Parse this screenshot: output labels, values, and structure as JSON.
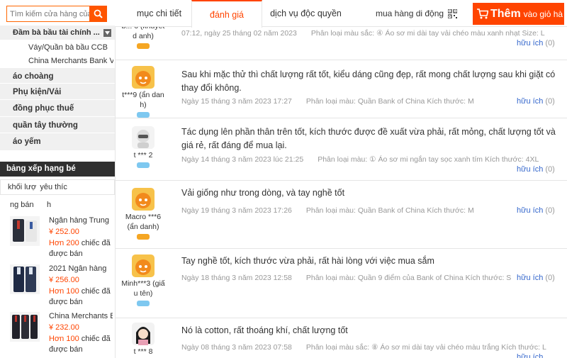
{
  "search": {
    "placeholder": "Tìm kiếm cửa hàng của"
  },
  "categories": {
    "header": "Đầm bà bầu tài chính ...",
    "subitems": [
      "Váy/Quần bà bầu CCB",
      "China Merchants Bank Vá..."
    ],
    "items": [
      "áo choàng",
      "Phụ kiện/Vải",
      "đồng phục thuế",
      "quần tây thường",
      "áo yếm"
    ]
  },
  "ranking": {
    "title": "bảng xếp hạng bé",
    "tabs": [
      "khối lượ",
      "yêu thíc"
    ],
    "cols": [
      "ng bán",
      "h"
    ],
    "items": [
      {
        "name": "Ngân hàng Trung",
        "price": "¥ 252.00",
        "more": "Hơn 200",
        "sold": " chiếc đã được bán"
      },
      {
        "name": "2021 Ngân hàng",
        "price": "¥ 256.00",
        "more": "Hơn 100",
        "sold": " chiếc đã được bán"
      },
      {
        "name": "China Merchants B",
        "price": "¥ 232.00",
        "more": "Hơn 100",
        "sold": " chiếc đã được bán"
      }
    ]
  },
  "tabs": {
    "detail": "mục chi tiết",
    "reviews": "đánh giá",
    "service": "dịch vụ độc quyền"
  },
  "mobile": {
    "label": "mua hàng di động"
  },
  "cart": {
    "big": "Thêm",
    "small": "vào giỏ hà"
  },
  "useful_label": "hữu ích",
  "reviews": [
    {
      "user": "b... 6 (khuyết d anh)",
      "text": "",
      "date": "07:12, ngày 25 tháng 02 năm 2023",
      "variant": "Phân loại màu sắc: ④ Áo sơ mi dài tay vải chéo màu xanh nhạt Size: L",
      "useful": "(0)"
    },
    {
      "user": "t***9 (ẩn danh)",
      "text": "Sau khi mặc thử thì chất lượng rất tốt, kiểu dáng cũng đẹp, rất mong chất lượng sau khi giặt có thay đổi không.",
      "date": "Ngày 15 tháng 3 năm 2023 17:27",
      "variant": "Phân loại màu: Quần Bank of China Kích thước: M",
      "useful": "(0)"
    },
    {
      "user": "t *** 2",
      "text": "Tác dụng lên phần thân trên tốt, kích thước được đề xuất vừa phải, rất mỏng, chất lượng tốt và giá rẻ, rất đáng để mua lại.",
      "date": "Ngày 14 tháng 3 năm 2023 lúc 21:25",
      "variant": "Phân loại màu: ① Áo sơ mi ngắn tay sọc xanh tím Kích thước: 4XL",
      "useful": "(0)"
    },
    {
      "user": "Macro ***6 (ẩn danh)",
      "text": "Vải giống như trong dòng, và tay nghề tốt",
      "date": "Ngày 19 tháng 3 năm 2023 17:26",
      "variant": "Phân loại màu: Quần Bank of China Kích thước: M",
      "useful": "(0)"
    },
    {
      "user": "Minh***3 (giấu tên)",
      "text": "Tay nghề tốt, kích thước vừa phải, rất hài lòng với việc mua sắm",
      "date": "Ngày 18 tháng 3 năm 2023 12:58",
      "variant": "Phân loại màu: Quần 9 điểm của Bank of China Kích thước: S",
      "useful": "(0)"
    },
    {
      "user": "t *** 8",
      "text": "Nó là cotton, rất thoáng khí, chất lượng tốt",
      "date": "Ngày 08 tháng 3 năm 2023 07:58",
      "variant": "Phân loại màu sắc: ⑧ Áo sơ mi dài tay vải chéo màu trắng Kích thước: L",
      "useful": ""
    }
  ]
}
